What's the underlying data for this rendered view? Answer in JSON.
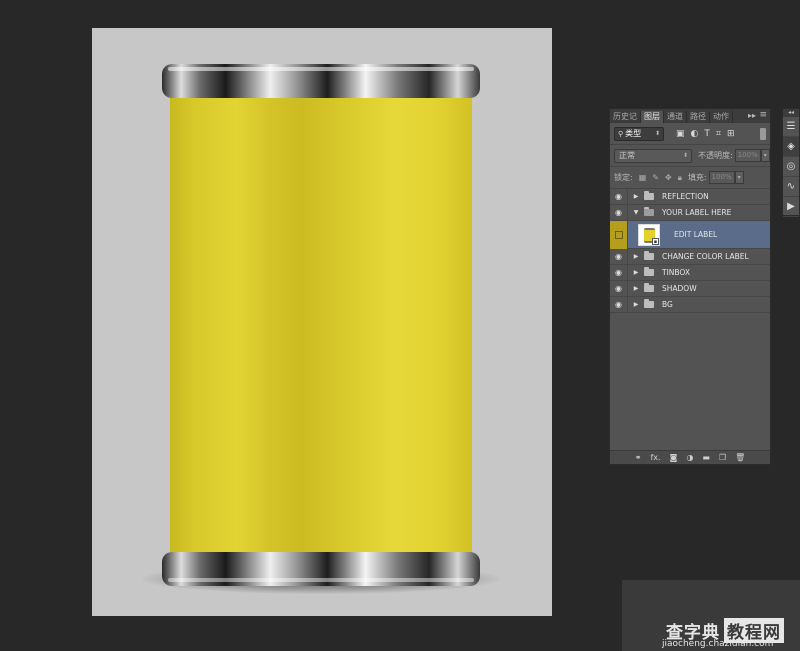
{
  "canvas": {
    "label_color": "#E2D433",
    "background_color": "#C6C7C6"
  },
  "panel": {
    "tabs": [
      "历史记",
      "图层",
      "通道",
      "路径",
      "动作"
    ],
    "active_tab": "图层",
    "collapse_icon": "double-arrow-right-icon",
    "menu_icon": "panel-menu-icon",
    "kind_filter": "类型",
    "filter_icons": [
      "image-filter-icon",
      "adjustment-filter-icon",
      "type-filter-icon",
      "shape-filter-icon",
      "smart-object-filter-icon"
    ],
    "blend_mode": "正常",
    "opacity_label": "不透明度:",
    "opacity_value": "100%",
    "lock_label": "锁定:",
    "fill_label": "填充:",
    "fill_value": "100%",
    "layers": [
      {
        "name": "REFLECTION",
        "type": "group",
        "expanded": false,
        "visible": true
      },
      {
        "name": "YOUR LABEL HERE",
        "type": "group",
        "expanded": true,
        "visible": true
      },
      {
        "name": "EDIT LABEL",
        "type": "smart-object",
        "selected": true,
        "visible": false,
        "child": true
      },
      {
        "name": "CHANGE COLOR LABEL",
        "type": "group",
        "expanded": false,
        "visible": true
      },
      {
        "name": "TINBOX",
        "type": "group",
        "expanded": false,
        "visible": true
      },
      {
        "name": "SHADOW",
        "type": "group",
        "expanded": false,
        "visible": true
      },
      {
        "name": "BG",
        "type": "group",
        "expanded": false,
        "visible": true
      }
    ],
    "footer_icons": [
      "link-layers-icon",
      "fx-icon",
      "mask-icon",
      "adjustment-layer-icon",
      "new-group-icon",
      "new-layer-icon",
      "delete-icon"
    ],
    "fx_label": "fx."
  },
  "side_strip": {
    "icons": [
      "properties-icon",
      "layers-panel-icon",
      "channels-icon",
      "paths-icon",
      "actions-icon"
    ]
  },
  "watermark": {
    "main": "查字典",
    "boxed": "教程网",
    "url": "jiaocheng.chazidian.com"
  }
}
